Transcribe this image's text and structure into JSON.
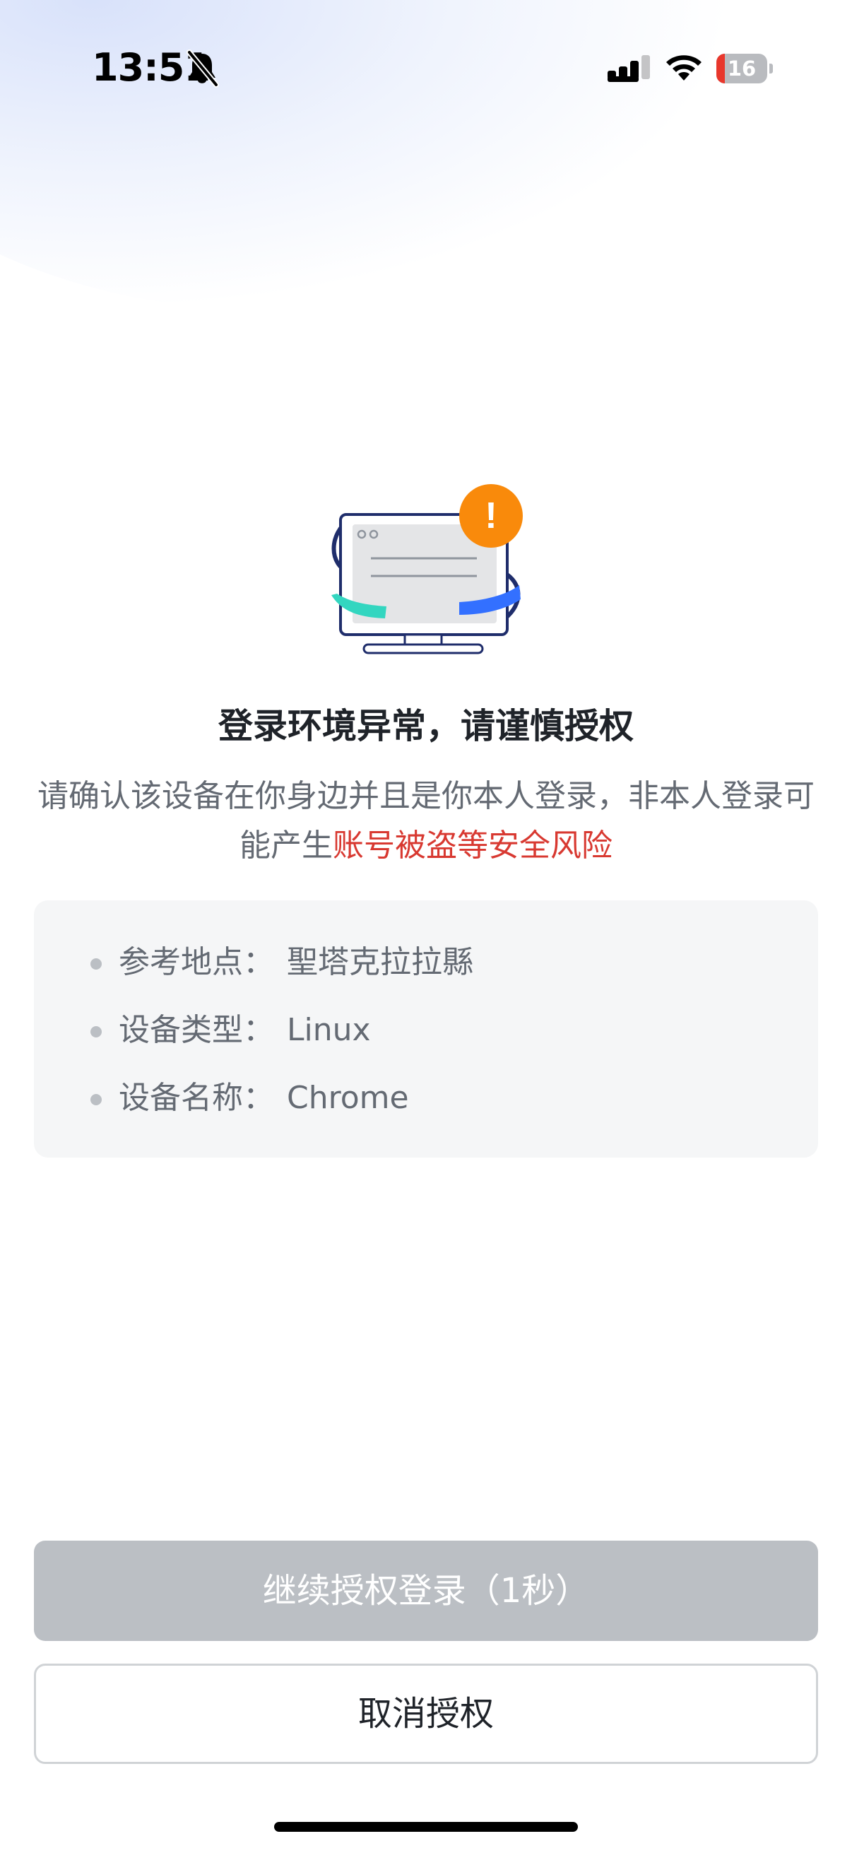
{
  "status_bar": {
    "time": "13:51",
    "battery_level": "16",
    "battery_fraction": 0.16,
    "icons": [
      "bell-off-icon",
      "signal-icon",
      "wifi-icon",
      "battery-icon"
    ]
  },
  "illustration": {
    "icon": "monitor-warning-icon",
    "alert_symbol": "!",
    "colors": {
      "alert": "#f98a0b",
      "accent_teal": "#33d6c0",
      "accent_blue": "#3370ff",
      "outline": "#1f2d6b"
    }
  },
  "title": "登录环境异常，请谨慎授权",
  "description": {
    "text": "请确认该设备在你身边并且是你本人登录，非本人登录可能产生",
    "risk_text": "账号被盗等安全风险"
  },
  "info": [
    {
      "label": "参考地点：",
      "value": "聖塔克拉拉縣"
    },
    {
      "label": "设备类型：",
      "value": "Linux"
    },
    {
      "label": "设备名称：",
      "value": "Chrome"
    }
  ],
  "buttons": {
    "continue_label": "继续授权登录（1秒）",
    "cancel_label": "取消授权"
  },
  "colors": {
    "risk_red": "#d83931",
    "disabled_button": "#bbbfc4",
    "card_bg": "#f5f6f7"
  }
}
